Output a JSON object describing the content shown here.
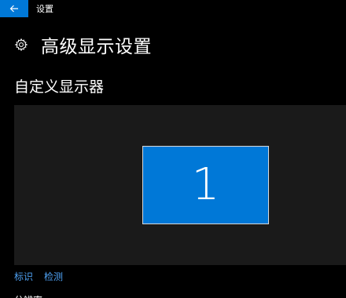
{
  "window": {
    "app_title": "设置",
    "back_icon": "arrow-left-icon",
    "accent_color": "#0078d7"
  },
  "header": {
    "icon": "gear-icon",
    "title": "高级显示设置"
  },
  "display_section": {
    "title": "自定义显示器",
    "monitor_number": "1",
    "monitor_color": "#0078d7",
    "links": {
      "identify": "标识",
      "detect": "检测"
    }
  },
  "next_section": {
    "label": "分辨率"
  }
}
